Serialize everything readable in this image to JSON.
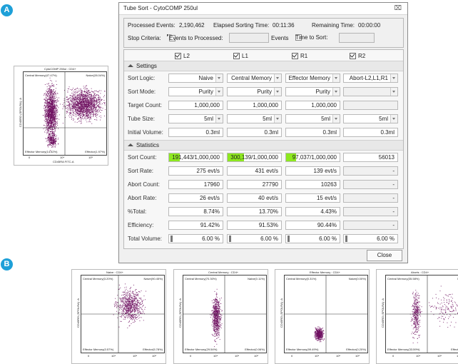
{
  "badges": {
    "a": "A",
    "b": "B"
  },
  "dialog": {
    "title": "Tube Sort - CytoCOMP 250ul",
    "close_x": "⌧",
    "processed_label": "Processed Events:",
    "processed_value": "2,190,462",
    "elapsed_label": "Elapsed Sorting Time:",
    "elapsed_value": "00:11:36",
    "remaining_label": "Remaining Time:",
    "remaining_value": "00:00:00",
    "stop_label": "Stop Criteria:",
    "events_to_processed": "Events to Processed:",
    "events_unit": "Events",
    "time_to_sort": "Time to Sort:",
    "columns": [
      "L2",
      "L1",
      "R1",
      "R2"
    ],
    "settings_label": "Settings",
    "statistics_label": "Statistics",
    "close_button": "Close",
    "settings_rows": [
      {
        "label": "Sort Logic:",
        "values": [
          "Naive",
          "Central Memory",
          "Effector Memory",
          "Abort-L2,L1,R1"
        ]
      },
      {
        "label": "Sort Mode:",
        "values": [
          "Purity",
          "Purity",
          "Purity",
          ""
        ]
      },
      {
        "label": "Target Count:",
        "values": [
          "1,000,000",
          "1,000,000",
          "1,000,000",
          ""
        ]
      },
      {
        "label": "Tube Size:",
        "values": [
          "5ml",
          "5ml",
          "5ml",
          "5ml"
        ]
      },
      {
        "label": "Initial Volume:",
        "values": [
          "0.3ml",
          "0.3ml",
          "0.3ml",
          "0.3ml"
        ]
      }
    ],
    "stats_rows": [
      {
        "label": "Sort Count:",
        "values": [
          "191,443/1,000,000",
          "300,139/1,000,000",
          "97,037/1,000,000",
          "56013"
        ],
        "fill": [
          0.19,
          0.3,
          0.097,
          0
        ]
      },
      {
        "label": "Sort Rate:",
        "values": [
          "275 evt/s",
          "431 evt/s",
          "139 evt/s",
          "-"
        ]
      },
      {
        "label": "Abort Count:",
        "values": [
          "17960",
          "27790",
          "10263",
          "-"
        ]
      },
      {
        "label": "Abort Rate:",
        "values": [
          "26 evt/s",
          "40 evt/s",
          "15 evt/s",
          "-"
        ]
      },
      {
        "label": "%Total:",
        "values": [
          "8.74%",
          "13.70%",
          "4.43%",
          "-"
        ]
      },
      {
        "label": "Efficiency:",
        "values": [
          "91.42%",
          "91.53%",
          "90.44%",
          "-"
        ]
      },
      {
        "label": "Total Volume:",
        "values": [
          "6.00 %",
          "6.00 %",
          "6.00 %",
          "6.00 %"
        ]
      }
    ]
  },
  "plot_a": {
    "title": "CytoCOMP 250ul : CD4+",
    "ylabel": "CD45RO (SPOLRA) :A",
    "xlabel": "CD45RA FITC-A",
    "quadrants": [
      "Central Memory(47.47%)",
      "Naive(28.04%)",
      "Effector Memory(14.52%)",
      "Effector(1.97%)"
    ],
    "xticks": [
      "0",
      "10⁴",
      "10⁵"
    ]
  },
  "plots_b": [
    {
      "title": "Naive : CD4+",
      "quadrants": [
        "Central Memory(3.20%)",
        "Naive(90.45%)",
        "Effector Memory(0.57%)",
        "Effector(5.78%)"
      ]
    },
    {
      "title": "Central Memory : CD4+",
      "quadrants": [
        "Central Memory(70.30%)",
        "Naive(0.11%)",
        "Effector Memory(29.54%)",
        "Effector(0.06%)"
      ]
    },
    {
      "title": "Effector Memory : CD4+",
      "quadrants": [
        "Central Memory(0.31%)",
        "Naive(0.00%)",
        "Effector Memory(99.49%)",
        "Effector(0.20%)"
      ]
    },
    {
      "title": "Aborts : CD4+",
      "quadrants": [
        "Central Memory(35.58%)",
        "Naive(2",
        "Effector Memory(33.59%)",
        "Effector(2.34"
      ]
    }
  ],
  "plots_b_xticks": [
    "0",
    "10⁴",
    "10⁵",
    "10⁶"
  ],
  "plots_b_ylabel": "CD45RO (SPOLRA) :A",
  "colors": {
    "dots": "#6e1060",
    "badge": "#1ea0d8",
    "fill_green": "#8de81f"
  }
}
